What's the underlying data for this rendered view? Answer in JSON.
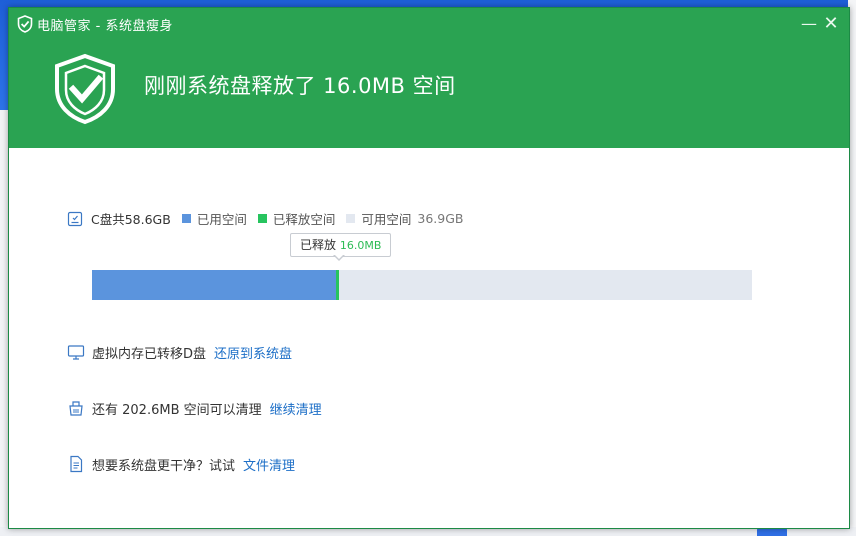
{
  "window": {
    "title": "电脑管家 - 系统盘瘦身",
    "headline": "刚刚系统盘释放了 16.0MB 空间"
  },
  "disk": {
    "total_label": "C盘共58.6GB",
    "used_label": "已用空间",
    "freed_label": "已释放空间",
    "free_label": "可用空间",
    "free_value": "36.9GB",
    "tooltip_label": "已释放",
    "tooltip_value": "16.0MB",
    "total_gb": 58.6,
    "used_gb": 21.7,
    "freed_gb": 0.016,
    "free_gb": 36.9
  },
  "rows": [
    {
      "text": "虚拟内存已转移D盘",
      "link": "还原到系统盘",
      "icon": "monitor-icon"
    },
    {
      "text": "还有 202.6MB 空间可以清理",
      "link": "继续清理",
      "icon": "cleanup-icon"
    },
    {
      "text": "想要系统盘更干净？试试",
      "link": "文件清理",
      "icon": "document-icon"
    }
  ],
  "colors": {
    "header": "#2aa352",
    "used": "#5b94dd",
    "freed": "#27c45f",
    "free": "#e3e8f0",
    "link": "#1d6fc7"
  }
}
